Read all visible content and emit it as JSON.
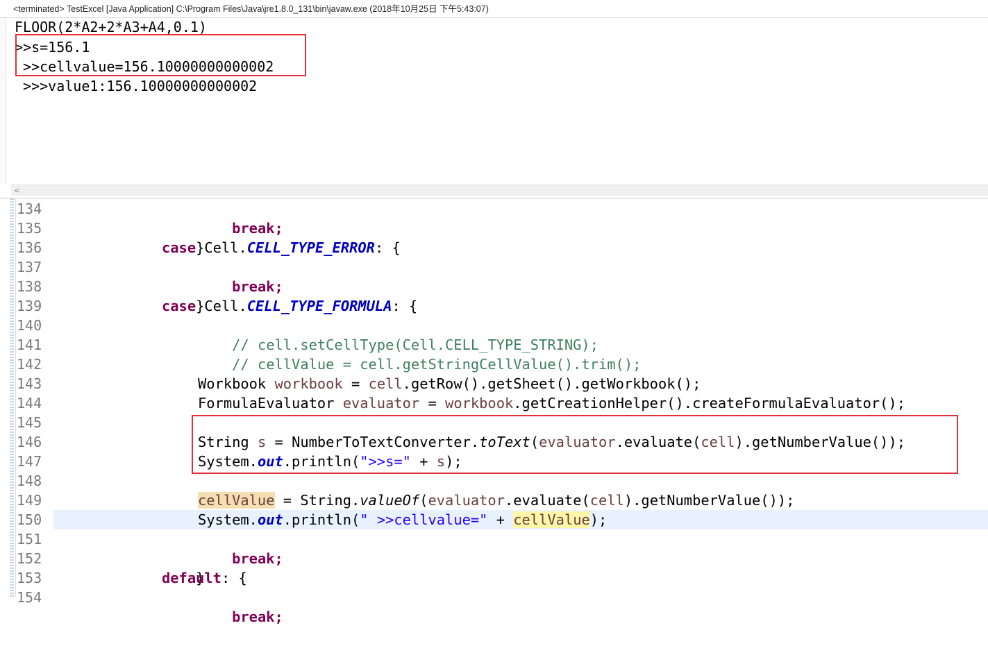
{
  "console": {
    "title": "<terminated> TestExcel [Java Application] C:\\Program Files\\Java\\jre1.8.0_131\\bin\\javaw.exe (2018年10月25日 下午5:43:07)",
    "lines": [
      "FLOOR(2*A2+2*A3+A4,0.1)",
      ">>s=156.1",
      " >>cellvalue=156.10000000000002",
      " >>>value1:156.10000000000002"
    ],
    "scroll_left_glyph": "<"
  },
  "editor": {
    "line_numbers": [
      "134",
      "135",
      "136",
      "137",
      "138",
      "139",
      "140",
      "141",
      "142",
      "143",
      "144",
      "145",
      "146",
      "147",
      "148",
      "149",
      "150",
      "151",
      "152",
      "153",
      "154"
    ],
    "tokens": {
      "break": "break;",
      "close_brace": "}",
      "case": "case",
      "cell_class": " Cell.",
      "cell_type_error": "CELL_TYPE_ERROR",
      "colon_brace": ": {",
      "cell_type_formula": "CELL_TYPE_FORMULA",
      "comment_140": "// cell.setCellType(Cell.CELL_TYPE_STRING);",
      "comment_141": "// cellValue = cell.getStringCellValue().trim();",
      "workbook_type": "Workbook ",
      "workbook_var": "workbook",
      "eq": " = ",
      "cell": "cell",
      "get_workbook_chain": ".getRow().getSheet().getWorkbook();",
      "evaluator_type": "FormulaEvaluator ",
      "evaluator_var": "evaluator",
      "create_evaluator_chain": ".getCreationHelper().createFormulaEvaluator();",
      "string_type": "String ",
      "s_var": "s",
      "converter": "NumberToTextConverter.",
      "to_text": "toText",
      "open_paren": "(",
      "evaluate": ".evaluate(",
      "number_value_chain": ").getNumberValue());",
      "system": "System.",
      "out": "out",
      "println_open": ".println(",
      "str_s": "\">>s=\"",
      "plus": " + ",
      "close_stmt": ");",
      "cell_value_var": "cellValue",
      "string_class": "String.",
      "value_of": "valueOf",
      "str_cellvalue": "\" >>cellvalue=\"",
      "default": "default",
      "partial_154": "break;"
    }
  }
}
